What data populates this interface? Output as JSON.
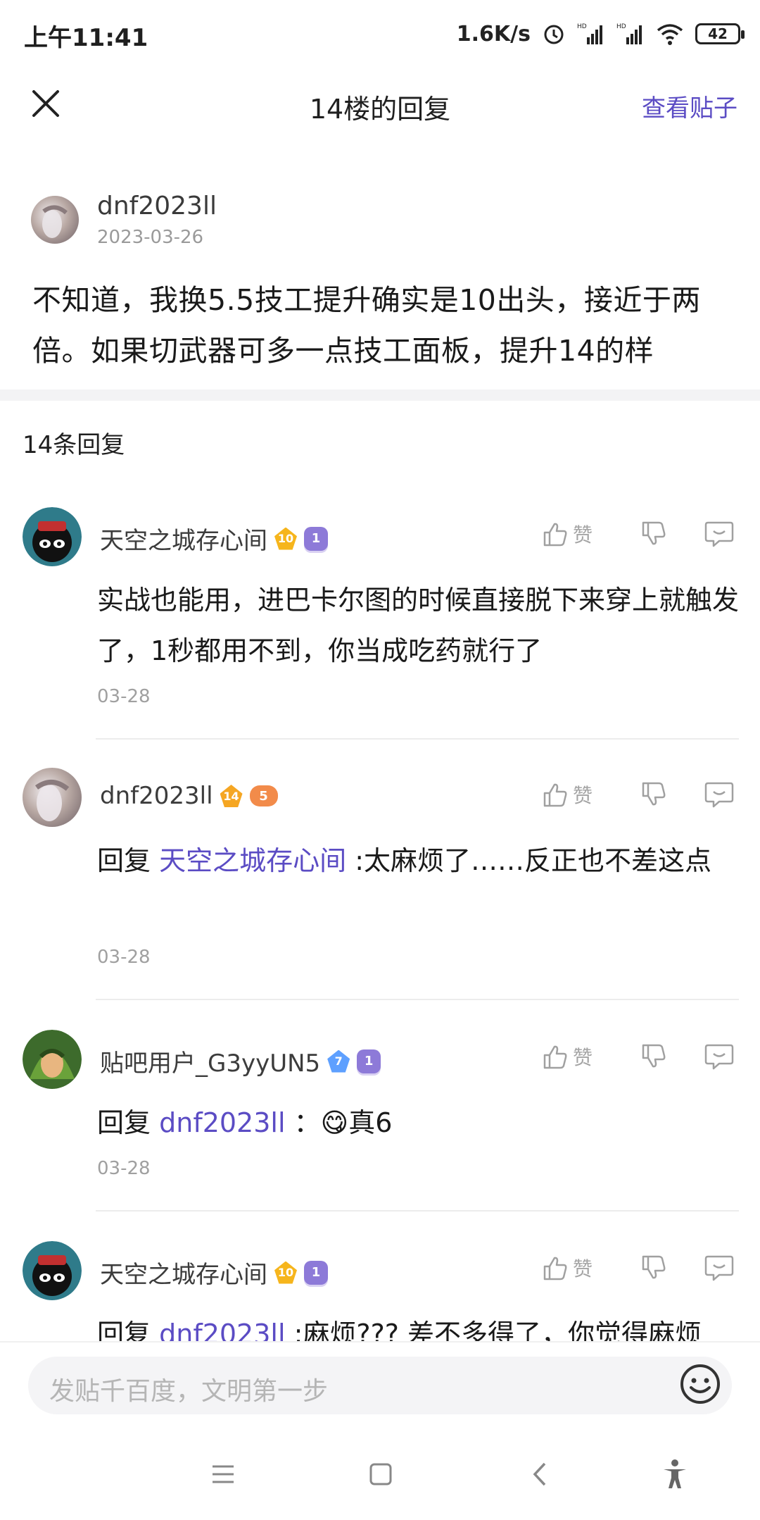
{
  "status_bar": {
    "time": "上午11:41",
    "net_speed": "1.6K/s",
    "battery": "42"
  },
  "header": {
    "title": "14楼的回复",
    "view_post": "查看贴子"
  },
  "op": {
    "username": "dnf2023ll",
    "date": "2023-03-26",
    "text": "不知道，我换5.5技工提升确实是10出头，接近于两倍。如果切武器可多一点技工面板，提升14的样"
  },
  "reply_count": "14条回复",
  "action_labels": {
    "like": "赞"
  },
  "replies": [
    {
      "username": "天空之城存心间",
      "level": "10",
      "pill_badge": "1",
      "text": "实战也能用，进巴卡尔图的时候直接脱下来穿上就触发了，1秒都用不到，你当成吃药就行了",
      "date": "03-28"
    },
    {
      "username": "dnf2023ll",
      "level": "14",
      "game_badge": "5",
      "reply_prefix": "回复",
      "mention": "天空之城存心间",
      "text": ":太麻烦了……反正也不差这点",
      "date": "03-28"
    },
    {
      "username": "贴吧用户_G3yyUN5",
      "level": "7",
      "pill_badge": "1",
      "reply_prefix": "回复",
      "mention": "dnf2023ll",
      "emoji": "😋",
      "text": "真6",
      "date": "03-28"
    },
    {
      "username": "天空之城存心间",
      "level": "10",
      "pill_badge": "1",
      "reply_prefix": "回复",
      "mention": "dnf2023ll",
      "text": ":麻烦??? 差不多得了，你觉得麻烦"
    }
  ],
  "input": {
    "placeholder": "发贴千百度，文明第一步"
  },
  "icons": {
    "close": "close-icon",
    "like": "thumbs-up-icon",
    "dislike": "thumbs-down-icon",
    "comment": "comment-icon",
    "emoji": "emoji-icon",
    "nav_menu": "menu-icon",
    "nav_home": "home-icon",
    "nav_back": "back-icon",
    "nav_access": "accessibility-icon"
  },
  "colors": {
    "accent": "#5b4cc4",
    "level_badge": "#f6b51c"
  }
}
